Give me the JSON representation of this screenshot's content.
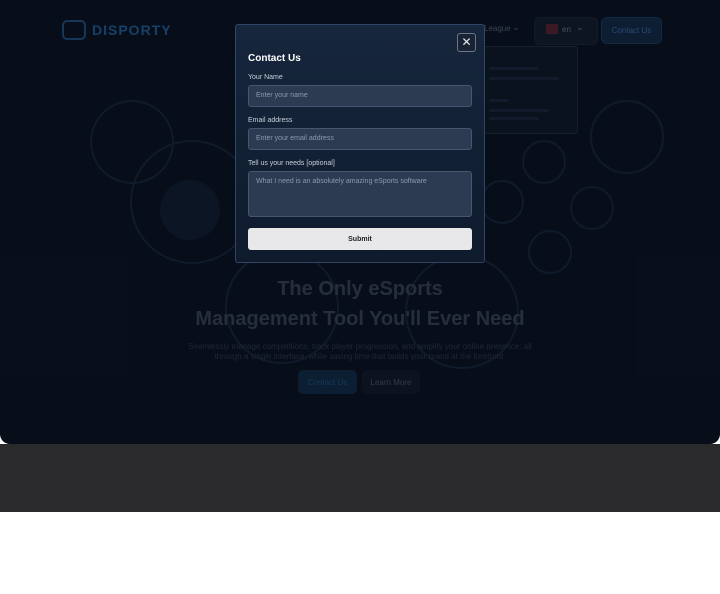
{
  "background_site": {
    "logo_text": "DISPORTY",
    "nav_language_link": "League",
    "language_selector": {
      "label": "en"
    },
    "contact_button": "Contact Us",
    "headline": [
      "The Only eSports",
      "Management Tool You'll Ever Need"
    ],
    "subheadline": [
      "Seamlessly manage competitions, track player progression, and amplify your online presence: all",
      "through a single interface, while saving time that builds your brand at the forefront."
    ],
    "primary_cta": "Contact Us",
    "secondary_cta": "Learn More"
  },
  "modal": {
    "title": "Contact Us",
    "close_icon": "close-icon",
    "name_label": "Your Name",
    "name_placeholder": "Enter your name",
    "email_label": "Email address",
    "email_placeholder": "Enter your email address",
    "needs_label": "Tell us your needs [optional]",
    "needs_placeholder": "What I need is an absolutely amazing eSports software",
    "submit_label": "Submit"
  },
  "colors": {
    "hero_bg": "#0a1220",
    "modal_bg": "#16263c",
    "submit_bg": "#e8e8ea",
    "band_bg": "#2a2a2d"
  }
}
